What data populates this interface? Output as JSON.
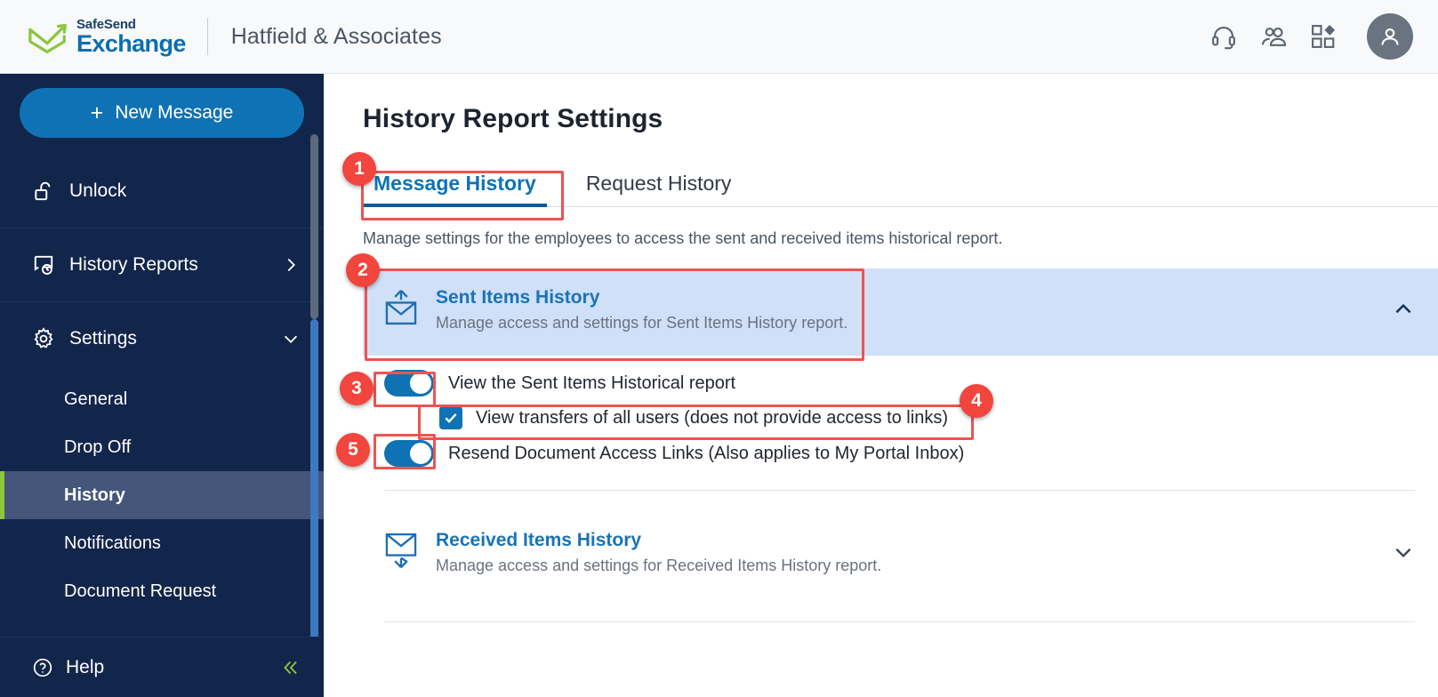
{
  "header": {
    "logo_top": "SafeSend",
    "logo_bottom": "Exchange",
    "org_name": "Hatfield & Associates",
    "icons": [
      {
        "name": "headset-icon",
        "label": "Support"
      },
      {
        "name": "people-icon",
        "label": "Contacts"
      },
      {
        "name": "apps-grid-icon",
        "label": "Apps"
      },
      {
        "name": "user-avatar-icon",
        "label": "Account"
      }
    ]
  },
  "sidebar": {
    "new_message_label": "New Message",
    "plus": "+",
    "items": [
      {
        "label": "Unlock",
        "icon": "unlock-icon",
        "chevron": "none"
      },
      {
        "label": "History Reports",
        "icon": "history-report-icon",
        "chevron": "right"
      },
      {
        "label": "Settings",
        "icon": "gear-icon",
        "chevron": "down"
      }
    ],
    "sub_items": [
      {
        "label": "General",
        "active": false
      },
      {
        "label": "Drop Off",
        "active": false
      },
      {
        "label": "History",
        "active": true
      },
      {
        "label": "Notifications",
        "active": false
      },
      {
        "label": "Document Request",
        "active": false
      }
    ],
    "help_label": "Help",
    "help_icon": "question-circle-icon",
    "collapse_icon": "chevron-double-left-icon"
  },
  "main": {
    "page_title": "History Report Settings",
    "tabs": [
      {
        "label": "Message History",
        "active": true
      },
      {
        "label": "Request History",
        "active": false
      }
    ],
    "section_description": "Manage settings for the employees to access the sent and received items historical report.",
    "panels": [
      {
        "title": "Sent Items History",
        "subtitle": "Manage access and settings for Sent Items History report.",
        "icon": "envelope-up-icon",
        "expanded": true,
        "chevron": "up",
        "options": [
          {
            "type": "toggle",
            "label": "View the Sent Items Historical report",
            "value": true
          },
          {
            "type": "checkbox",
            "label": "View transfers of all users (does not provide access to links)",
            "value": true
          },
          {
            "type": "toggle",
            "label": "Resend Document Access Links (Also applies to My Portal Inbox)",
            "value": true
          }
        ]
      },
      {
        "title": "Received Items History",
        "subtitle": "Manage access and settings for Received Items History report.",
        "icon": "envelope-down-icon",
        "expanded": false,
        "chevron": "down",
        "options": []
      }
    ]
  },
  "annotations": [
    {
      "number": "1",
      "target": "tab-message-history"
    },
    {
      "number": "2",
      "target": "panel-sent-items-history"
    },
    {
      "number": "3",
      "target": "toggle-view-sent-items-report"
    },
    {
      "number": "4",
      "target": "checkbox-view-transfers-all-users"
    },
    {
      "number": "5",
      "target": "toggle-resend-document-access-links"
    }
  ],
  "colors": {
    "brand_blue": "#0f72b5",
    "sidebar_navy": "#12254a",
    "accent_green": "#8dc63f",
    "panel_highlight": "#cfe0f8",
    "annotation_red": "#ef5350"
  }
}
